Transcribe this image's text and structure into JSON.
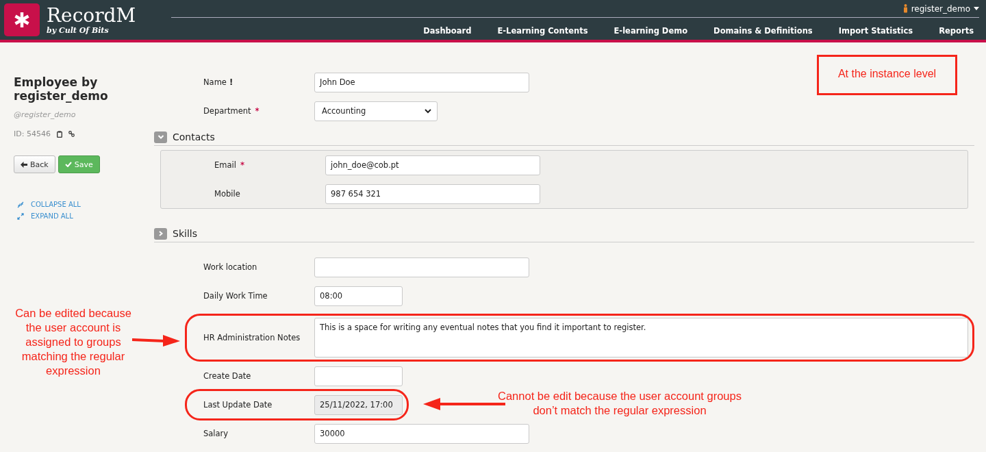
{
  "header": {
    "logo_title": "RecordM",
    "logo_subtitle": "by Cult Of Bits",
    "user": "register_demo",
    "nav": [
      {
        "label": "Dashboard"
      },
      {
        "label": "E-Learning Contents"
      },
      {
        "label": "E-learning Demo"
      },
      {
        "label": "Domains & Definitions"
      },
      {
        "label": "Import Statistics"
      },
      {
        "label": "Reports"
      }
    ]
  },
  "sidebar": {
    "title": "Employee by register_demo",
    "username": "@register_demo",
    "id": "ID: 54546",
    "back": "Back",
    "save": "Save",
    "links": [
      {
        "kind": "collapse",
        "label": "COLLAPSE ALL"
      },
      {
        "kind": "expand",
        "label": "EXPAND ALL"
      }
    ]
  },
  "fields_top": [
    {
      "label": "Name",
      "marker": "!",
      "kind": "text",
      "value": "John Doe"
    },
    {
      "label": "Department",
      "marker": "*",
      "kind": "select",
      "value": "Accounting"
    }
  ],
  "sections": [
    {
      "title": "Contacts",
      "expanded": true,
      "fields": [
        {
          "label": "Email",
          "marker": "*",
          "kind": "text",
          "value": "john_doe@cob.pt"
        },
        {
          "label": "Mobile",
          "kind": "text",
          "value": "987 654 321"
        }
      ]
    },
    {
      "title": "Skills",
      "expanded": false
    }
  ],
  "fields_bottom": [
    {
      "label": "Work location",
      "kind": "text",
      "highlighted": false
    },
    {
      "label": "Daily Work Time",
      "kind": "text",
      "value": "08:00",
      "highlighted": false
    },
    {
      "label": "HR Administration Notes",
      "kind": "textarea",
      "value": "This is a space for writing any eventual notes that you find it important to register.",
      "highlighted": true
    },
    {
      "label": "Create Date",
      "kind": "text",
      "highlighted": false
    },
    {
      "label": "Last Update Date",
      "kind": "readonly",
      "value": "25/11/2022, 17:00",
      "highlighted": true
    },
    {
      "label": "Salary",
      "kind": "text",
      "value": "30000",
      "highlighted": false
    }
  ],
  "annotations": {
    "instance": "At the instance level",
    "left": "Can be edited because the user account is assigned to groups matching the regular expression",
    "right": "Cannot be edit because the user account groups don’t match the regular expression"
  }
}
